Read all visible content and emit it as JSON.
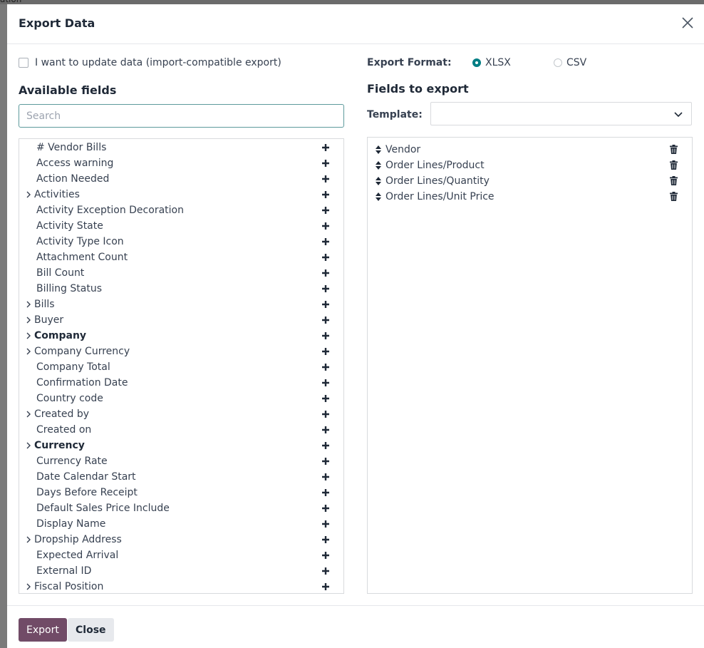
{
  "backdrop": {
    "fragment": "ation"
  },
  "dialog": {
    "title": "Export Data"
  },
  "import_compat": {
    "label": "I want to update data (import-compatible export)",
    "checked": false
  },
  "available": {
    "title": "Available fields",
    "search_placeholder": "Search",
    "fields": [
      {
        "label": "# Vendor Bills",
        "expandable": false,
        "bold": false
      },
      {
        "label": "Access warning",
        "expandable": false,
        "bold": false
      },
      {
        "label": "Action Needed",
        "expandable": false,
        "bold": false
      },
      {
        "label": "Activities",
        "expandable": true,
        "bold": false
      },
      {
        "label": "Activity Exception Decoration",
        "expandable": false,
        "bold": false
      },
      {
        "label": "Activity State",
        "expandable": false,
        "bold": false
      },
      {
        "label": "Activity Type Icon",
        "expandable": false,
        "bold": false
      },
      {
        "label": "Attachment Count",
        "expandable": false,
        "bold": false
      },
      {
        "label": "Bill Count",
        "expandable": false,
        "bold": false
      },
      {
        "label": "Billing Status",
        "expandable": false,
        "bold": false
      },
      {
        "label": "Bills",
        "expandable": true,
        "bold": false
      },
      {
        "label": "Buyer",
        "expandable": true,
        "bold": false
      },
      {
        "label": "Company",
        "expandable": true,
        "bold": true
      },
      {
        "label": "Company Currency",
        "expandable": true,
        "bold": false
      },
      {
        "label": "Company Total",
        "expandable": false,
        "bold": false
      },
      {
        "label": "Confirmation Date",
        "expandable": false,
        "bold": false
      },
      {
        "label": "Country code",
        "expandable": false,
        "bold": false
      },
      {
        "label": "Created by",
        "expandable": true,
        "bold": false
      },
      {
        "label": "Created on",
        "expandable": false,
        "bold": false
      },
      {
        "label": "Currency",
        "expandable": true,
        "bold": true
      },
      {
        "label": "Currency Rate",
        "expandable": false,
        "bold": false
      },
      {
        "label": "Date Calendar Start",
        "expandable": false,
        "bold": false
      },
      {
        "label": "Days Before Receipt",
        "expandable": false,
        "bold": false
      },
      {
        "label": "Default Sales Price Include",
        "expandable": false,
        "bold": false
      },
      {
        "label": "Display Name",
        "expandable": false,
        "bold": false
      },
      {
        "label": "Dropship Address",
        "expandable": true,
        "bold": false
      },
      {
        "label": "Expected Arrival",
        "expandable": false,
        "bold": false
      },
      {
        "label": "External ID",
        "expandable": false,
        "bold": false
      },
      {
        "label": "Fiscal Position",
        "expandable": true,
        "bold": false
      }
    ]
  },
  "format": {
    "label": "Export Format:",
    "options": [
      {
        "label": "XLSX",
        "checked": true
      },
      {
        "label": "CSV",
        "checked": false
      }
    ]
  },
  "to_export": {
    "title": "Fields to export",
    "template_label": "Template:",
    "template_value": "",
    "fields": [
      "Vendor",
      "Order Lines/Product",
      "Order Lines/Quantity",
      "Order Lines/Unit Price"
    ]
  },
  "footer": {
    "export_label": "Export",
    "close_label": "Close"
  },
  "colors": {
    "primary": "#714b67",
    "accent": "#017e84"
  },
  "icons": {
    "close": "close-icon",
    "expand": "chevron-right-icon",
    "add": "plus-icon",
    "sort": "sort-handle-icon",
    "delete": "trash-icon",
    "dropdown": "chevron-down-icon"
  }
}
